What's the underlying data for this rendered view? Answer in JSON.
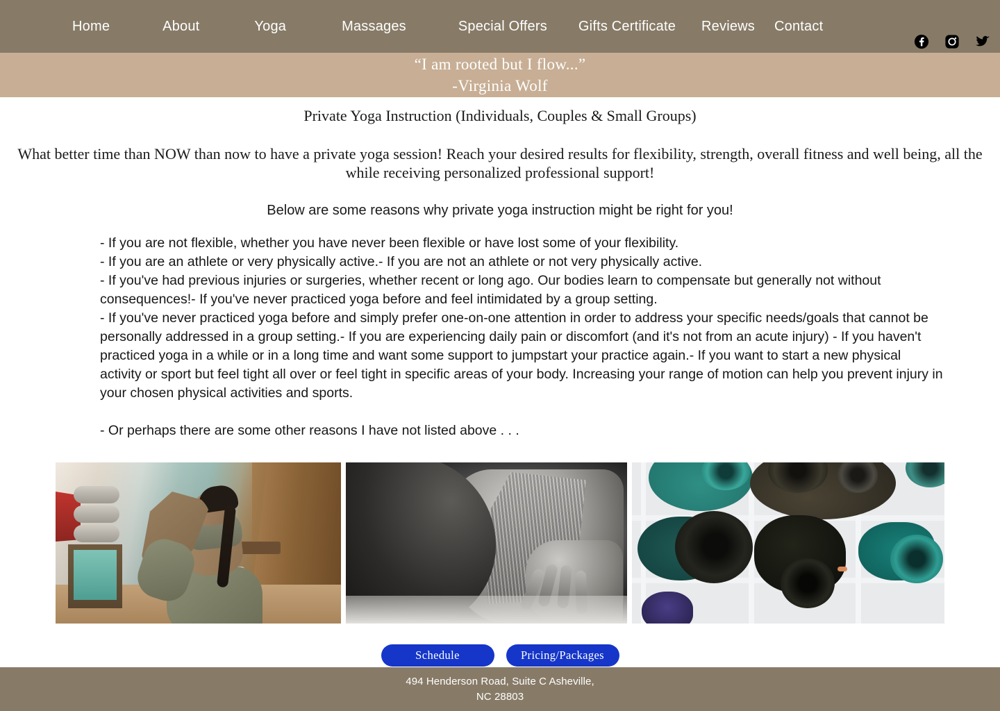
{
  "nav": {
    "items": [
      {
        "label": "Home"
      },
      {
        "label": "About"
      },
      {
        "label": "Yoga"
      },
      {
        "label": "Massages"
      },
      {
        "label": "Special Offers"
      },
      {
        "label": "Gifts Certificate"
      },
      {
        "label": "Reviews"
      },
      {
        "label": "Contact"
      }
    ],
    "social": [
      {
        "name": "facebook-icon"
      },
      {
        "name": "instagram-icon"
      },
      {
        "name": "twitter-icon"
      }
    ],
    "background_color": "#877b67",
    "text_color": "#ffffff"
  },
  "quote_band": {
    "quote": "“I am rooted but I flow...”",
    "attribution": "-Virginia Wolf",
    "background_color": "#c7ae94",
    "text_color": "#ffffff"
  },
  "main": {
    "heading": "Private Yoga Instruction (Individuals, Couples & Small Groups)",
    "lead": "What better time than NOW than now to have a private yoga session! Reach your desired results for flexibility, strength, overall fitness and well being, all the while receiving personalized professional support!",
    "subhead": "Below are some reasons why private yoga instruction might be right for you!",
    "reasons": [
      "- If you are not flexible, whether you have never been flexible or have lost some of your flexibility.",
      "- If you are an athlete or very physically active.- If you are not an athlete or not very physically active.",
      "- If you've had previous injuries or surgeries, whether recent or long ago. Our bodies learn to compensate but generally not without consequences!- If you've never practiced yoga before and feel intimidated by a group setting.",
      "- If you've never practiced yoga before and simply prefer one-on-one attention in order to address your specific needs/goals that cannot be personally addressed in a group setting.- If you are experiencing daily pain or discomfort (and it's not from an acute injury) - If you haven't practiced yoga in a while or in a long time and want some support to jumpstart your practice again.- If you want to start a new physical activity or sport but feel tight all over or feel tight in specific areas of your body. Increasing your range of motion can help you prevent injury in your chosen physical activities and sports.",
      "- Or perhaps there are some other reasons I have not listed above . . ."
    ],
    "gallery": [
      {
        "name": "photo-woman-yoga-pose",
        "alt": "Woman in seated side-bend yoga pose in studio"
      },
      {
        "name": "photo-bw-closeup",
        "alt": "Black and white close-up of shoulder and hand"
      },
      {
        "name": "photo-rolled-mats",
        "alt": "Rolled yoga mats stored in white cubby shelves"
      }
    ],
    "buttons": {
      "schedule": "Schedule",
      "pricing": "Pricing/Packages",
      "color": "#1536c8"
    }
  },
  "footer": {
    "address_line1": "494 Henderson Road, Suite C Asheville,",
    "address_line2": "NC 28803",
    "background_color": "#877b67",
    "text_color": "#ffffff"
  }
}
